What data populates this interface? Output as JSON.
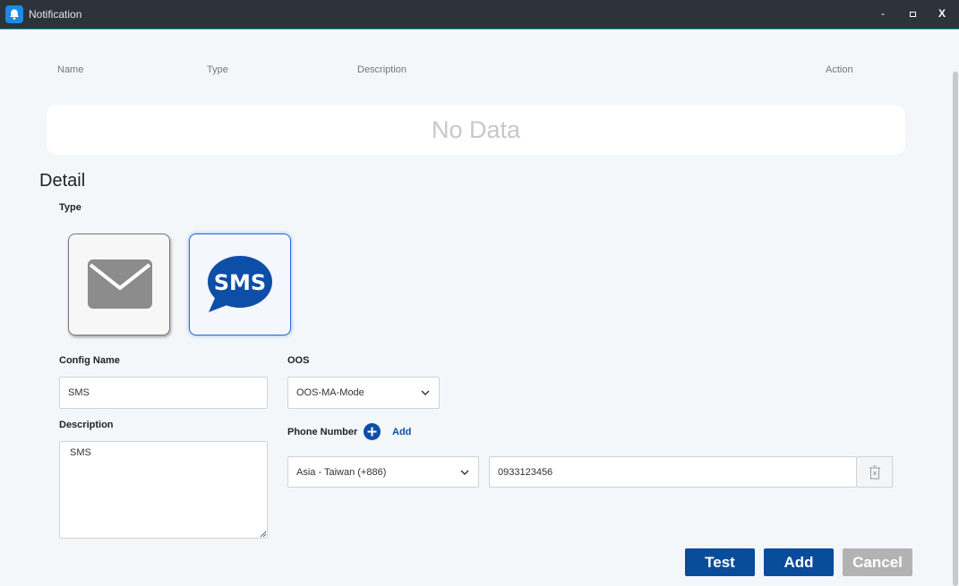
{
  "window": {
    "title": "Notification",
    "controls": {
      "minimize": "-",
      "close": "X"
    }
  },
  "table": {
    "headers": [
      "Name",
      "Type",
      "Description",
      "Action"
    ],
    "empty_text": "No Data"
  },
  "detail": {
    "title": "Detail",
    "type_label": "Type",
    "types": [
      {
        "name": "Email",
        "icon": "envelope-icon",
        "selected": false
      },
      {
        "name": "SMS",
        "icon": "sms-bubble-icon",
        "icon_text": "SMS",
        "selected": true
      }
    ],
    "config_name": {
      "label": "Config Name",
      "value": "SMS"
    },
    "description": {
      "label": "Description",
      "value": "SMS"
    },
    "oos": {
      "label": "OOS",
      "value": "OOS-MA-Mode"
    },
    "phone": {
      "label": "Phone Number",
      "add_label": "Add",
      "country": "Asia - Taiwan (+886)",
      "number": "0933123456"
    }
  },
  "buttons": {
    "test": "Test",
    "add": "Add",
    "cancel": "Cancel"
  },
  "colors": {
    "primary": "#0a4c9c",
    "disabled": "#b3b3b3",
    "titlebar": "#2d333b",
    "sms_icon": "#0d4fa8",
    "envelope_icon": "#8c8c8c"
  }
}
